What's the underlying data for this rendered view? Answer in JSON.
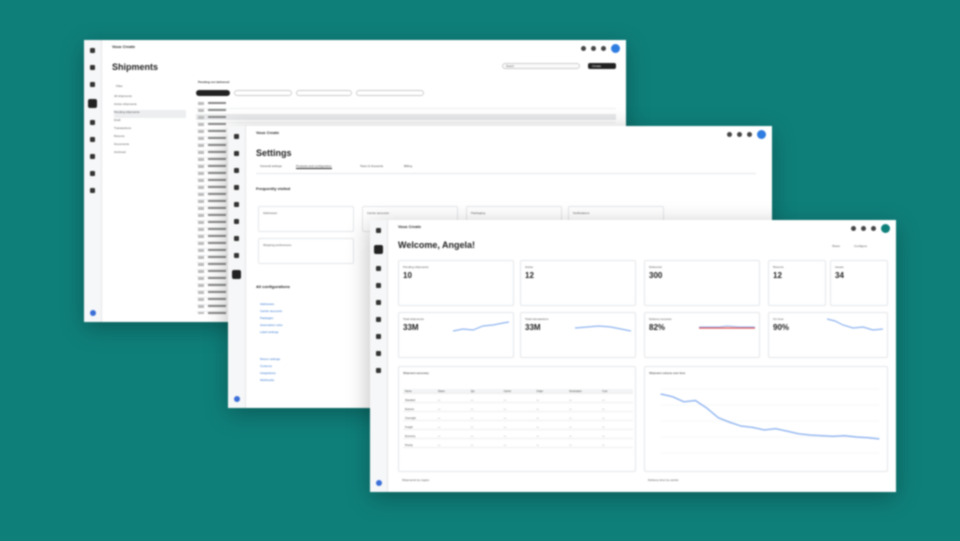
{
  "shipments_window": {
    "app_name": "Vous Create",
    "app_sub": "",
    "title": "Shipments",
    "filter_label": "Filter",
    "sidebar_items": [
      "All shipments",
      "Active shipments",
      "Pending shipments",
      "Draft",
      "Transactions",
      "Returns",
      "Documents",
      "Archived"
    ],
    "table_heading": "Pending not delivered",
    "primary_button": "Create",
    "search_placeholder": "Search"
  },
  "settings_window": {
    "app_name": "Vous Create",
    "title": "Settings",
    "tabs": [
      "General settings",
      "Products and configuration",
      "Team & Accounts",
      "Billing"
    ],
    "section_frequent": "Frequently visited",
    "frequent_cards": [
      "Addresses",
      "Shipping preferences",
      "Carrier accounts",
      "Packaging",
      "Notifications"
    ],
    "section_all": "All configurations",
    "config_links": [
      "Addresses",
      "Carrier accounts",
      "Packages",
      "Automation rules",
      "Label settings",
      "Return settings",
      "Customs",
      "Integrations",
      "Webhooks"
    ]
  },
  "dashboard_window": {
    "app_name": "Vous Create",
    "title": "Welcome, Angela!",
    "header_actions": [
      "Share",
      "Configure"
    ],
    "kpis": [
      {
        "label": "Pending shipments",
        "value": "10"
      },
      {
        "label": "Active",
        "value": "12"
      },
      {
        "label": "Delivered",
        "value": "300"
      },
      {
        "label": "Returns",
        "value": "12"
      },
      {
        "label": "Issues",
        "value": "34"
      }
    ],
    "kpis2": [
      {
        "label": "Total shipments",
        "value": "33M"
      },
      {
        "label": "Total transactions",
        "value": "33M"
      },
      {
        "label": "Delivery success",
        "value": "82%"
      },
      {
        "label": "On time",
        "value": "90%"
      }
    ],
    "table_title": "Shipment summary",
    "table_columns": [
      "Name",
      "Status",
      "Qty",
      "Carrier",
      "Origin",
      "Destination",
      "Cost"
    ],
    "table_rows": [
      [
        "Standard",
        "—",
        "—",
        "—",
        "—",
        "—",
        "—"
      ],
      [
        "Express",
        "—",
        "—",
        "—",
        "—",
        "—",
        "—"
      ],
      [
        "Overnight",
        "—",
        "—",
        "—",
        "—",
        "—",
        "—"
      ],
      [
        "Freight",
        "—",
        "—",
        "—",
        "—",
        "—",
        "—"
      ],
      [
        "Economy",
        "—",
        "—",
        "—",
        "—",
        "—",
        "—"
      ],
      [
        "Priority",
        "—",
        "—",
        "—",
        "—",
        "—",
        "—"
      ]
    ],
    "chart_title": "Shipment volume over time",
    "footer_left": "Shipments by region",
    "footer_right": "Delivery time by carrier",
    "accent": "#2f7de1",
    "line_color": "#8fb4f0",
    "alert_color": "#e24b4b"
  },
  "chart_data": {
    "type": "line",
    "title": "Shipment volume over time",
    "x": [
      1,
      2,
      3,
      4,
      5,
      6,
      7,
      8,
      9,
      10,
      11,
      12,
      13,
      14,
      15,
      16,
      17,
      18,
      19,
      20
    ],
    "series": [
      {
        "values": [
          92,
          88,
          80,
          82,
          70,
          55,
          48,
          42,
          40,
          36,
          38,
          34,
          30,
          28,
          27,
          26,
          27,
          25,
          24,
          22
        ]
      }
    ],
    "ylim": [
      0,
      100
    ]
  }
}
